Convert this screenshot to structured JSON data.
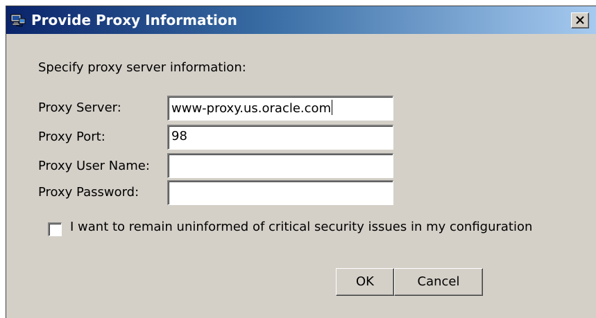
{
  "window": {
    "title": "Provide Proxy Information",
    "icon": "computer-network-icon",
    "close_glyph": "×"
  },
  "instructions": "Specify proxy server information:",
  "fields": [
    {
      "label": "Proxy Server:",
      "value": "www-proxy.us.oracle.com",
      "focused": true
    },
    {
      "label": "Proxy Port:",
      "value": "98",
      "focused": false
    },
    {
      "label": "Proxy User Name:",
      "value": "",
      "focused": false
    },
    {
      "label": "Proxy Password:",
      "value": "",
      "focused": false
    }
  ],
  "checkbox": {
    "label": "I want to remain uninformed of critical security issues in my configuration",
    "checked": false
  },
  "buttons": {
    "ok": "OK",
    "cancel": "Cancel"
  },
  "colors": {
    "title_bar_start": "#0a246a",
    "title_bar_end": "#a6caf0",
    "dialog_background": "#d4d0c8"
  }
}
